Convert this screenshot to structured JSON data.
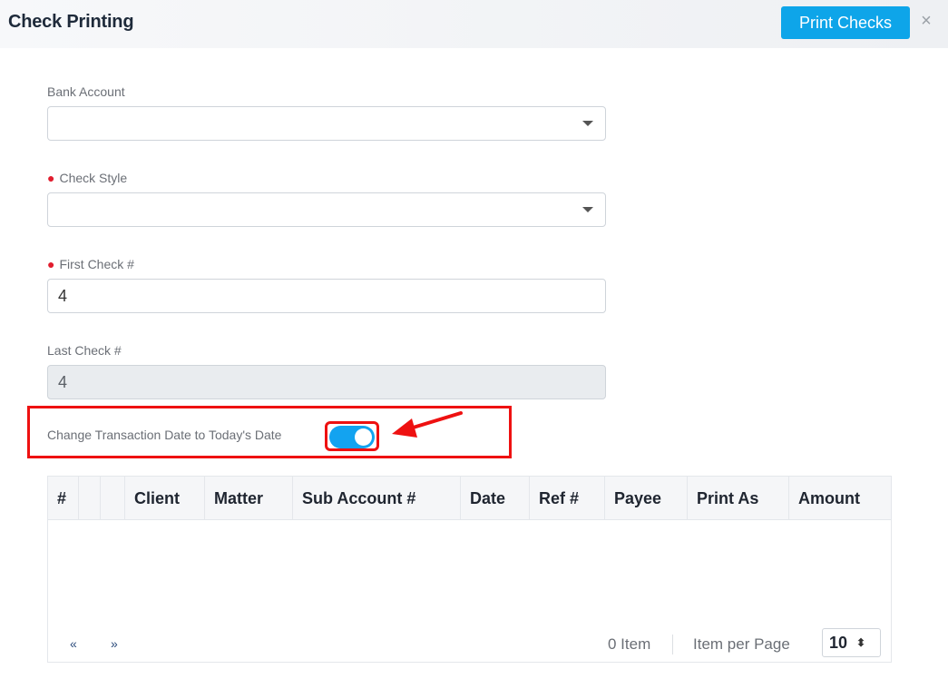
{
  "header": {
    "title": "Check Printing",
    "print_label": "Print Checks",
    "close_glyph": "×"
  },
  "form": {
    "bank_account": {
      "label": "Bank Account",
      "value": ""
    },
    "check_style": {
      "label": "Check Style",
      "required_marker": "●",
      "value": ""
    },
    "first_check": {
      "label": "First Check #",
      "required_marker": "●",
      "value": "4"
    },
    "last_check": {
      "label": "Last Check #",
      "value": "4"
    },
    "change_date": {
      "label": "Change Transaction Date to Today's Date",
      "enabled": true
    }
  },
  "table": {
    "columns": [
      "#",
      "",
      "",
      "Client",
      "Matter",
      "Sub Account #",
      "Date",
      "Ref #",
      "Payee",
      "Print As",
      "Amount"
    ],
    "rows": []
  },
  "pagination": {
    "prev": "«",
    "next": "»",
    "item_count": "0 Item",
    "per_page_label": "Item per Page",
    "per_page_value": "10",
    "per_page_caret": "⬍"
  },
  "colors": {
    "accent": "#0ea5e9",
    "toggle_on": "#13a3f0",
    "annotation_red": "#ee1111",
    "required_dot": "#e11d2e"
  },
  "icons": {
    "close": "close-icon",
    "dropdown": "chevron-down-icon",
    "annotation": "red-arrow-icon"
  }
}
